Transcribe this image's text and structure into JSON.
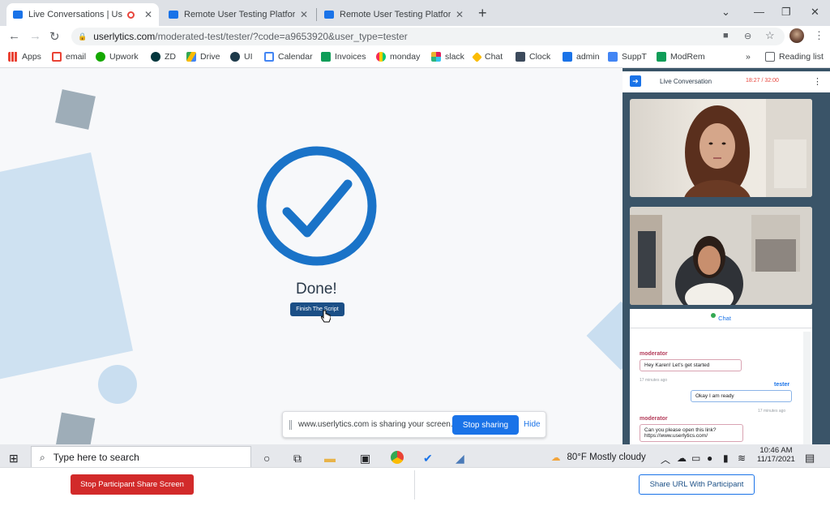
{
  "browser": {
    "tabs": [
      {
        "label": "Live Conversations | Userlytic"
      },
      {
        "label": "Remote User Testing Platform | U"
      },
      {
        "label": "Remote User Testing Platform | U"
      }
    ],
    "url_domain": "userlytics.com",
    "url_path": "/moderated-test/tester/?code=a9653920&user_type=tester",
    "bookmarks": [
      "Apps",
      "email",
      "Upwork",
      "ZD",
      "Drive",
      "UI",
      "Calendar",
      "Invoices",
      "monday",
      "slack",
      "Chat",
      "Clock",
      "admin",
      "SuppT",
      "ModRem"
    ],
    "reading_list": "Reading list"
  },
  "main": {
    "done_label": "Done!",
    "finish_button": "Finish The Script",
    "share_text": "www.userlytics.com is sharing your screen.",
    "stop_sharing": "Stop sharing",
    "hide": "Hide"
  },
  "panel": {
    "title": "Live Conversation",
    "timer": "18:27 / 32:00",
    "chat_tab": "Chat",
    "messages": [
      {
        "sender": "moderator",
        "text": "Hey Karen! Let's get started",
        "time": "17 minutes ago"
      },
      {
        "sender": "tester",
        "text": "Okay I am ready",
        "time": "17 minutes ago"
      },
      {
        "sender": "moderator",
        "text": "Can you please open this link?",
        "link": "https://www.userlytics.com/"
      }
    ]
  },
  "taskbar": {
    "search_placeholder": "Type here to search",
    "weather": "80°F  Mostly cloudy",
    "time": "10:46 AM",
    "date": "11/17/2021"
  },
  "bottom": {
    "stop_participant": "Stop Participant Share Screen",
    "share_url": "Share URL With Participant"
  }
}
